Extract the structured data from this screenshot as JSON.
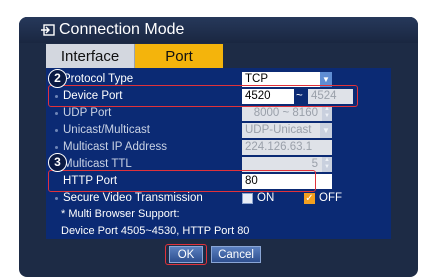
{
  "dialog": {
    "title": "Connection Mode",
    "tabs": [
      {
        "label": "Interface",
        "active": false
      },
      {
        "label": "Port",
        "active": true
      }
    ]
  },
  "badges": {
    "step2": "2",
    "step3": "3"
  },
  "rows": {
    "protocol_type": {
      "label": "Protocol Type",
      "value": "TCP"
    },
    "device_port": {
      "label": "Device Port",
      "start": "4520",
      "separator": "~",
      "end": "4524"
    },
    "udp_port": {
      "label": "UDP Port",
      "value": "8000 ~ 8160"
    },
    "unicast_multicast": {
      "label": "Unicast/Multicast",
      "value": "UDP-Unicast"
    },
    "multicast_ip": {
      "label": "Multicast IP Address",
      "value": "224.126.63.1"
    },
    "multicast_ttl": {
      "label": "Multicast TTL",
      "value": "5"
    },
    "http_port": {
      "label": "HTTP Port",
      "value": "80"
    },
    "secure_video": {
      "label": "Secure Video Transmission",
      "on_label": "ON",
      "off_label": "OFF",
      "selected": "OFF"
    }
  },
  "notes": {
    "line1": "* Multi Browser Support:",
    "line2": "Device Port 4505~4530, HTTP Port 80"
  },
  "buttons": {
    "ok": "OK",
    "cancel": "Cancel"
  },
  "colors": {
    "accent": "#f4b40c",
    "highlight": "#e0323a",
    "panel": "#0b2a74"
  }
}
